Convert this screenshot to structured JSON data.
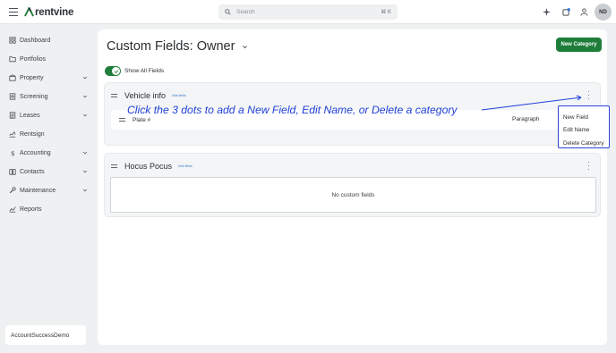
{
  "header": {
    "logo_text": "rentvine",
    "search_placeholder": "Search",
    "search_shortcut": "⌘ K",
    "avatar_initials": "ND",
    "brand_color": "#1e7d3a"
  },
  "sidebar": {
    "items": [
      {
        "label": "Dashboard",
        "icon": "grid-icon",
        "expandable": false
      },
      {
        "label": "Portfolios",
        "icon": "folder-icon",
        "expandable": false
      },
      {
        "label": "Property",
        "icon": "property-icon",
        "expandable": true
      },
      {
        "label": "Screening",
        "icon": "screening-icon",
        "expandable": true
      },
      {
        "label": "Leases",
        "icon": "lease-icon",
        "expandable": true
      },
      {
        "label": "Rentsign",
        "icon": "signature-icon",
        "expandable": false
      },
      {
        "label": "Accounting",
        "icon": "dollar-icon",
        "expandable": true
      },
      {
        "label": "Contacts",
        "icon": "book-icon",
        "expandable": true
      },
      {
        "label": "Maintenance",
        "icon": "wrench-icon",
        "expandable": true
      },
      {
        "label": "Reports",
        "icon": "chart-icon",
        "expandable": false
      }
    ],
    "account_name": "AccountSuccessDemo"
  },
  "main": {
    "title": "Custom Fields: Owner",
    "new_category_label": "New Category",
    "show_all_label": "Show All Fields",
    "show_all_enabled": true,
    "categories": [
      {
        "name": "Vehicle info",
        "hide_label": "hide fields",
        "fields": [
          {
            "name": "Plate #",
            "type": "Paragraph"
          }
        ]
      },
      {
        "name": "Hocus Pocus",
        "hide_label": "hide fields",
        "empty_text": "No custom fields"
      }
    ]
  },
  "annotation": {
    "text": "Click the 3 dots to add a New Field, Edit Name, or Delete a category",
    "color": "#1f3fd8"
  },
  "dropdown_menu": {
    "items": [
      "New Field",
      "Edit Name",
      "Delete Category"
    ]
  }
}
